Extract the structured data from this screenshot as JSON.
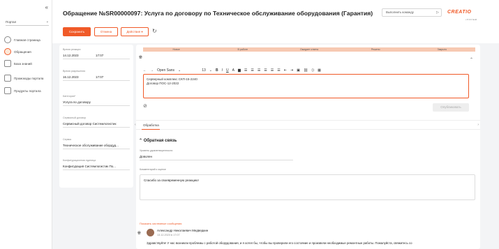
{
  "nav": {
    "collapse": "«",
    "portal_label": "Портал",
    "items": [
      {
        "label": "Главная страница",
        "icon": "home-icon"
      },
      {
        "label": "Обращения",
        "icon": "alert-icon"
      },
      {
        "label": "База знаний",
        "icon": "book-icon"
      },
      {
        "label": "Промокоды портала",
        "icon": "ticket-icon"
      },
      {
        "label": "Продукты портала",
        "icon": "product-icon"
      }
    ]
  },
  "header": {
    "title": "Обращение №SR00000097: Услуга по договору по Техническое обслуживание оборудования (Гарантия)",
    "command_placeholder": "Выполнить команду",
    "logo": "CREATIO",
    "logo_sub": "v 8.0.0 build",
    "buttons": {
      "save": "Сохранить",
      "cancel": "Отмена",
      "actions": "Действия ▾"
    }
  },
  "info": {
    "reaction_time_label": "Время реакции",
    "reaction_date": "14.12.2023",
    "reaction_time": "17:07",
    "resolve_time_label": "Время разрешения",
    "resolve_date": "16.12.2023",
    "resolve_time": "17:07",
    "category_label": "Категория*",
    "category": "Услуга по договору",
    "contract_label": "Сервисный договор",
    "contract": "Сервисный договор Системлогистик",
    "service_label": "Сервис",
    "service": "Техническое обслуживание обордуд...",
    "config_label": "Конфигурационная единица",
    "config": "Конфигурация Системлогистик По..."
  },
  "stages": [
    "Новое",
    "В работе",
    "Ожидает ответа",
    "Решено",
    "Закрыто"
  ],
  "editor": {
    "font": "Open Sans",
    "size": "13",
    "lines": [
      "Серверный комплекс СКП-15-2240",
      "Договор ПОС-12-2022"
    ],
    "publish": "Опубликовать"
  },
  "tabs": {
    "active": "Обработка"
  },
  "feedback": {
    "title": "Обратная связь",
    "satisfaction_label": "Уровень удовлетворенности",
    "satisfaction": "Доволен",
    "comment_label": "Комментарий к оценке",
    "comment": "Спасибо за своевременную реакцию!"
  },
  "messages": {
    "show_system": "Показать системные сообщения",
    "author": "Александр Николаевич Медведкин",
    "date": "13.12.2023 в 17:07",
    "text": "Здравствуйте! У нас возникли проблемы с работой оборудования, и я хотел бы, чтобы вы проверили его состояние и произвели необходимые ремонтные работы. Пожалуйста, свяжитесь со"
  }
}
